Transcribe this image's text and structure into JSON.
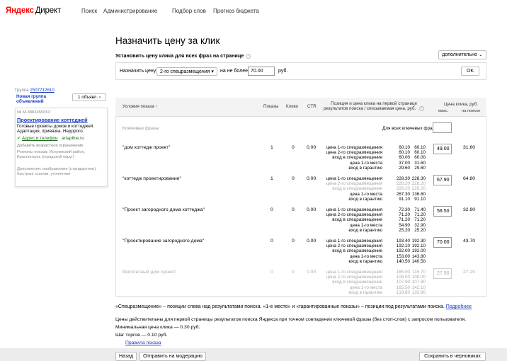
{
  "header": {
    "logo_brand": "Яндекс",
    "logo_product": "Директ",
    "nav": [
      "Поиск",
      "Администрирование",
      "Подбор слов",
      "Прогноз бюджета"
    ]
  },
  "page_title": "Назначить цену за клик",
  "subheading": "Установить цену клика для всех фраз на странице",
  "more_button": "дополнительно",
  "settings": {
    "label_assign": "Назначить цену",
    "strategy_value": "2-го спецразмещения",
    "label_no_more": "на не более",
    "price_value": "70.00",
    "currency": "руб.",
    "ok": "OK"
  },
  "card": {
    "group_label": "Группа",
    "group_id": "2507712610",
    "group_name": "Новая группа объявлений",
    "ads_count": "1 объявл.",
    "ad_number": "№ M-3882455653",
    "ad_title": "Проектирование коттеджей",
    "ad_text": "Готовые проекты домов и коттеджей. Адаптация, привязка. Недорого.",
    "address_link": "Адрес и телефон",
    "domain": "artapline.ru",
    "age_restriction": "Добавить возрастное ограничение",
    "regions": "Регионы показа: Истринский район, Красногорск (городской округ)",
    "extras": "Дополнения: изображение (стандартное), быстрые ссылки, уточнения"
  },
  "table": {
    "headers": {
      "conditions": "Условия показа",
      "shows": "Показы",
      "clicks": "Клики",
      "ctr": "CTR",
      "position": "Позиция и цена клика на первой странице результатов поиска / списываемая цена, руб.",
      "price": "Цена клика, руб.",
      "max": "макс.",
      "on_search": "на поиске"
    },
    "keywords_label": "Ключевые фразы",
    "all_keywords_label": "Для всех ключевых фраз",
    "position_labels": [
      "цена 1-го спецразмещения",
      "цена 2-го спецразмещения",
      "вход в спецразмещение",
      "цена 1-го места",
      "вход в гарантию"
    ],
    "rows": [
      {
        "phrase": "\"дом коттедж проект\"",
        "shows": "1",
        "clicks": "0",
        "ctr": "0.00",
        "col1": [
          "60.10",
          "60.10",
          "60.00",
          "37.00",
          "29.60"
        ],
        "col2": [
          "60.10",
          "60.10",
          "60.00",
          "31.60",
          "29.60"
        ],
        "max": "49.00",
        "search": "31.60"
      },
      {
        "phrase": "\"коттедж проектирование\"",
        "shows": "1",
        "clicks": "0",
        "ctr": "0.00",
        "col1": [
          "228.30",
          "228.20",
          "228.20",
          "267.30",
          "91.10"
        ],
        "col2": [
          "228.30",
          "228.20",
          "228.20",
          "136.60",
          "91.10"
        ],
        "max": "67.90",
        "search": "64.80"
      },
      {
        "phrase": "\"Проект загородного дома коттеджа\"",
        "shows": "0",
        "clicks": "0",
        "ctr": "0.00",
        "col1": [
          "72.30",
          "71.20",
          "71.20",
          "54.90",
          "25.20"
        ],
        "col2": [
          "71.40",
          "71.20",
          "71.20",
          "32.90",
          "25.20"
        ],
        "max": "58.50",
        "search": "32.90"
      },
      {
        "phrase": "\"Проектирование загородного дома\"",
        "shows": "0",
        "clicks": "0",
        "ctr": "0.00",
        "col1": [
          "193.40",
          "192.10",
          "192.00",
          "153.00",
          "140.50"
        ],
        "col2": [
          "192.30",
          "192.10",
          "192.00",
          "143.80",
          "140.50"
        ],
        "max": "70.00",
        "search": "43.70"
      },
      {
        "phrase": "бесплатный дом проект",
        "shows": "0",
        "clicks": "0",
        "ctr": "0.00",
        "col1": [
          "165.00",
          "108.00",
          "107.90",
          "165.50",
          "133.80"
        ],
        "col2": [
          "115.70",
          "108.00",
          "107.90",
          "142.10",
          "133.80"
        ],
        "max": "27.90",
        "search": "27.20"
      }
    ]
  },
  "footer": {
    "note": "«Спецразмещение» – позиции слева над результатами поиска. «1-е место» и «гарантированные показы» – позиции под результатами поиска.",
    "more_link": "Подробнее",
    "line1": "Цены действительны для первой страницы результатов поиска Яндекса при точном совпадении ключевой фразы (без стоп-слов) с запросом пользователя.",
    "line2": "Минимальная цена клика — 0.30 руб.",
    "line3": "Шаг торгов — 0.10 руб.",
    "rules_link": "Правила показа",
    "back": "Назад",
    "send": "Отправить на модерацию",
    "save": "Сохранить в черновиках"
  }
}
